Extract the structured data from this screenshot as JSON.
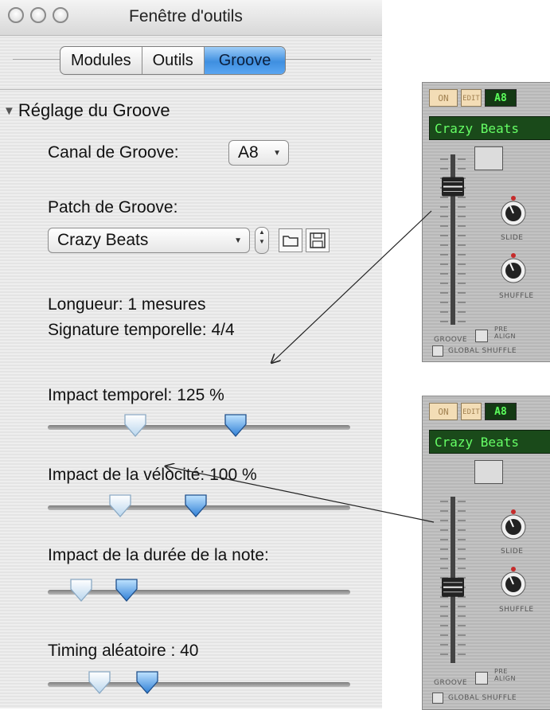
{
  "window": {
    "title": "Fenêtre d'outils"
  },
  "tabs": [
    {
      "label": "Modules",
      "active": false
    },
    {
      "label": "Outils",
      "active": false
    },
    {
      "label": "Groove",
      "active": true
    }
  ],
  "section": {
    "title": "Réglage du Groove",
    "expanded": true
  },
  "groove_channel": {
    "label": "Canal de Groove:",
    "value": "A8"
  },
  "groove_patch": {
    "label": "Patch de Groove:",
    "value": "Crazy Beats"
  },
  "info": {
    "length": "Longueur: 1 mesures",
    "signature": "Signature temporelle: 4/4"
  },
  "sliders": [
    {
      "label": "Impact temporel: 125 %",
      "original_level": 0.29,
      "value_level": 0.62
    },
    {
      "label": "Impact de la vélocité: 100 %",
      "original_level": 0.24,
      "value_level": 0.49
    },
    {
      "label": "Impact de la durée de la note:",
      "original_level": 0.11,
      "value_level": 0.26
    },
    {
      "label": "Timing aléatoire : 40",
      "original_level": 0.17,
      "value_level": 0.33
    }
  ],
  "panel_top": {
    "on_label": "ON",
    "edit_label": "EDIT",
    "channel": "A8",
    "patch": "Crazy Beats",
    "fader_level": 0.85,
    "knob1_label": "SLIDE",
    "knob2_label": "SHUFFLE",
    "groove_label": "GROOVE",
    "pre_align_label_1": "PRE",
    "pre_align_label_2": "ALIGN",
    "global_shuffle_label": "GLOBAL SHUFFLE"
  },
  "panel_bottom": {
    "on_label": "ON",
    "edit_label": "EDIT",
    "channel": "A8",
    "patch": "Crazy Beats",
    "fader_level": 0.45,
    "knob1_label": "SLIDE",
    "knob2_label": "SHUFFLE",
    "groove_label": "GROOVE",
    "pre_align_label_1": "PRE",
    "pre_align_label_2": "ALIGN",
    "global_shuffle_label": "GLOBAL SHUFFLE"
  },
  "colors": {
    "accent": "#3f8fe0",
    "lcd_bg": "#1a4a1a",
    "lcd_text": "#66ff66"
  }
}
